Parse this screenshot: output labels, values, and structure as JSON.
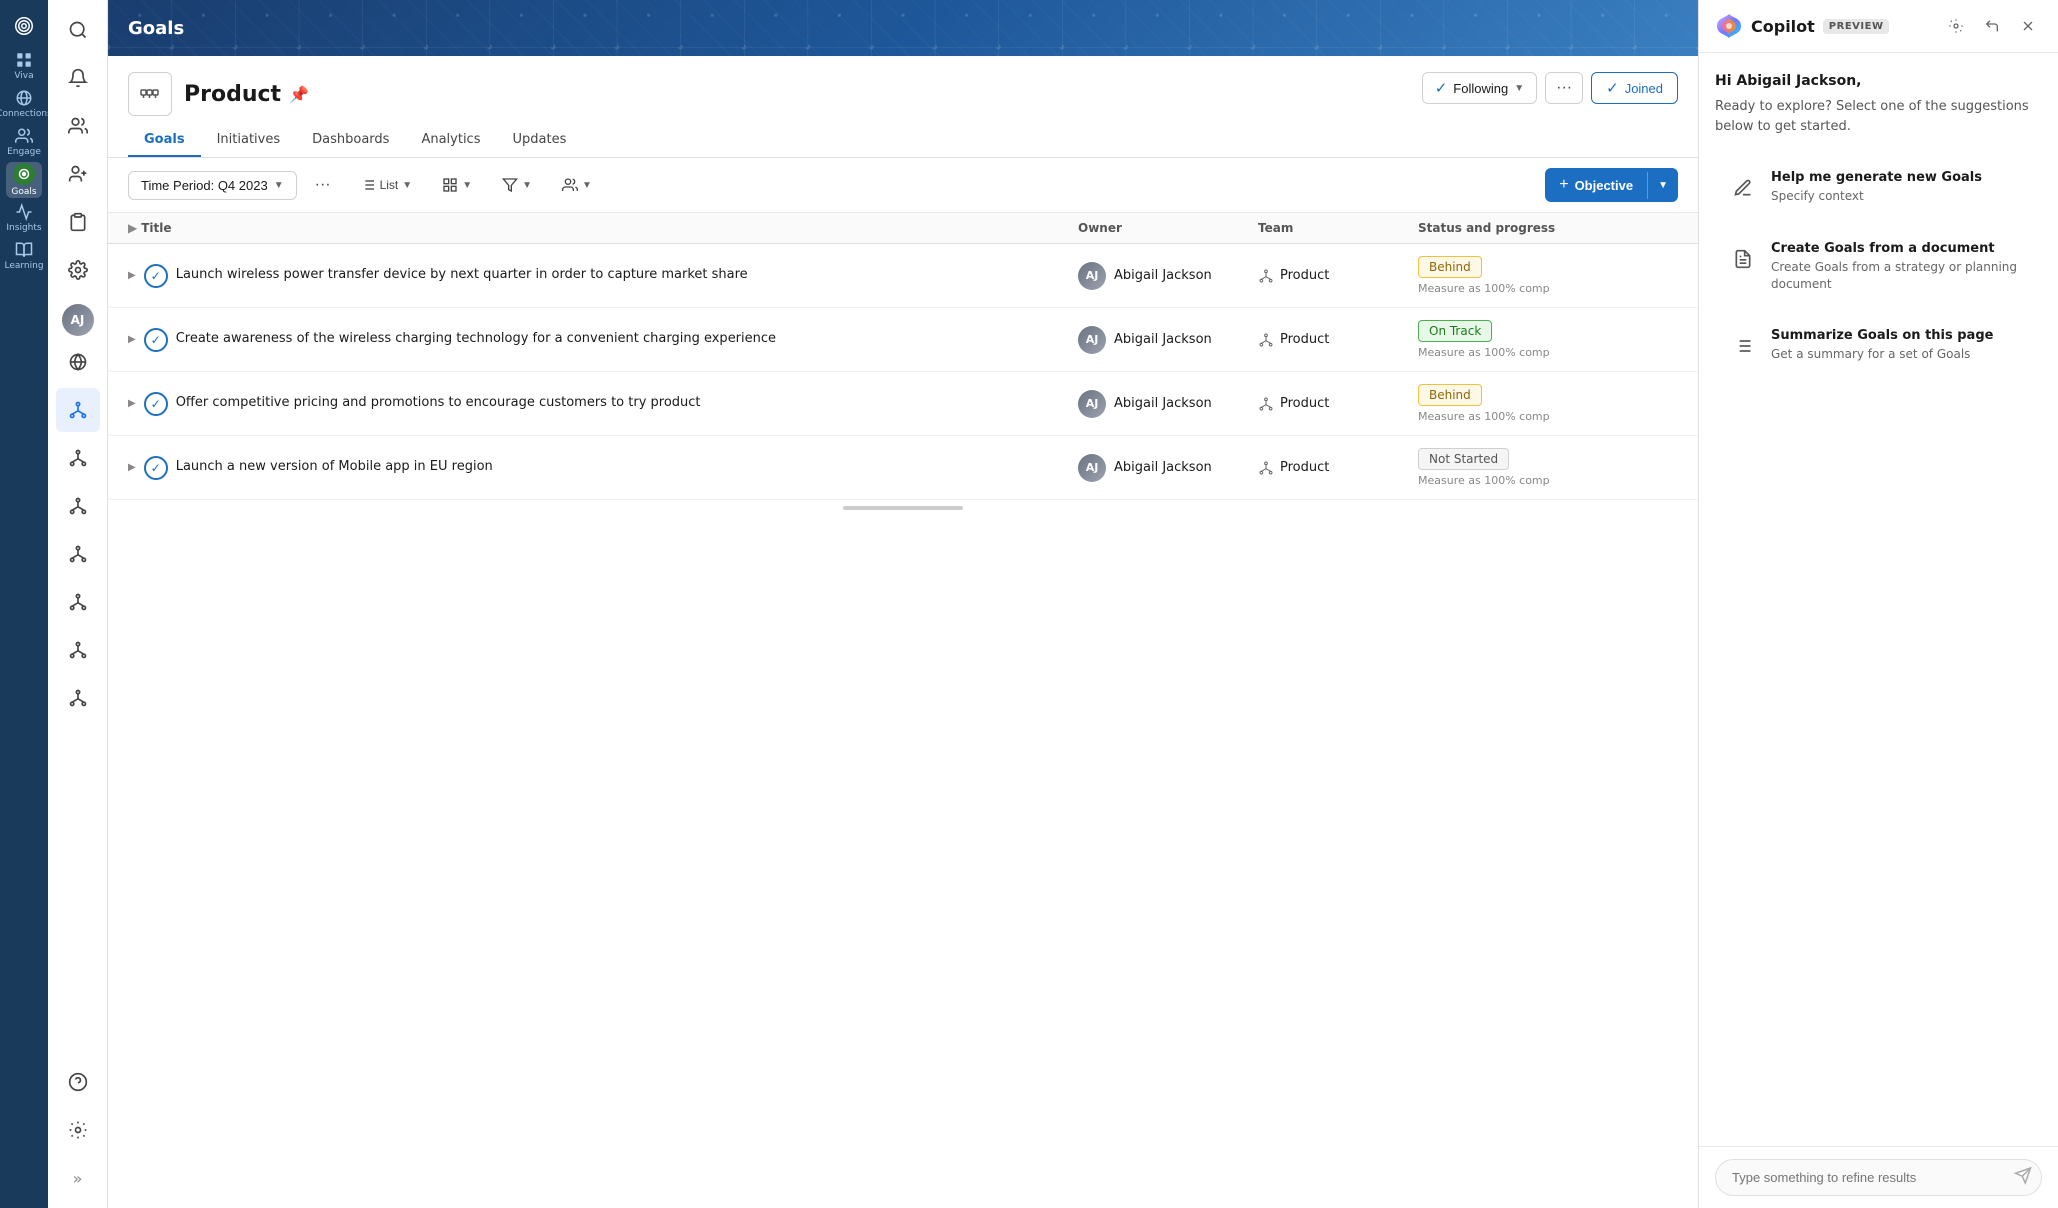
{
  "app": {
    "title": "Goals"
  },
  "farLeftNav": {
    "items": [
      {
        "id": "viva",
        "label": "Viva",
        "icon": "grid"
      },
      {
        "id": "connections",
        "label": "Connections",
        "icon": "globe"
      },
      {
        "id": "engage",
        "label": "Engage",
        "icon": "people"
      },
      {
        "id": "goals",
        "label": "Goals",
        "icon": "target",
        "active": true
      },
      {
        "id": "insights",
        "label": "Insights",
        "icon": "chart"
      },
      {
        "id": "learning",
        "label": "Learning",
        "icon": "book"
      }
    ]
  },
  "sidebar": {
    "items": [
      {
        "id": "search",
        "icon": "search"
      },
      {
        "id": "bell",
        "icon": "bell"
      },
      {
        "id": "people-group",
        "icon": "people-group"
      },
      {
        "id": "person-add",
        "icon": "person-add"
      },
      {
        "id": "clipboard",
        "icon": "clipboard"
      },
      {
        "id": "settings",
        "icon": "settings"
      },
      {
        "id": "avatar",
        "icon": "avatar"
      },
      {
        "id": "globe",
        "icon": "globe"
      },
      {
        "id": "hierarchy-active",
        "icon": "hierarchy",
        "active": true
      },
      {
        "id": "hierarchy1",
        "icon": "hierarchy"
      },
      {
        "id": "hierarchy2",
        "icon": "hierarchy"
      },
      {
        "id": "hierarchy3",
        "icon": "hierarchy"
      },
      {
        "id": "hierarchy4",
        "icon": "hierarchy"
      },
      {
        "id": "hierarchy5",
        "icon": "hierarchy"
      },
      {
        "id": "hierarchy6",
        "icon": "hierarchy"
      },
      {
        "id": "hierarchy7",
        "icon": "hierarchy"
      },
      {
        "id": "help",
        "icon": "help"
      },
      {
        "id": "settings2",
        "icon": "settings"
      }
    ]
  },
  "header": {
    "title": "Goals"
  },
  "page": {
    "title": "Product",
    "pinned": true,
    "tabs": [
      {
        "id": "goals",
        "label": "Goals",
        "active": true
      },
      {
        "id": "initiatives",
        "label": "Initiatives"
      },
      {
        "id": "dashboards",
        "label": "Dashboards"
      },
      {
        "id": "analytics",
        "label": "Analytics"
      },
      {
        "id": "updates",
        "label": "Updates"
      }
    ],
    "followingButton": "Following",
    "joinedButton": "Joined"
  },
  "toolbar": {
    "timePeriod": "Time Period: Q4 2023",
    "dotsLabel": "···",
    "objectiveButton": "Objective"
  },
  "table": {
    "columns": {
      "title": "Title",
      "owner": "Owner",
      "team": "Team",
      "status": "Status and progress"
    },
    "rows": [
      {
        "id": 1,
        "title": "Launch wireless power transfer device by next quarter in order to capture market share",
        "owner": "Abigail Jackson",
        "team": "Product",
        "status": "Behind",
        "statusType": "behind",
        "measure": "Measure as 100% comp"
      },
      {
        "id": 2,
        "title": "Create awareness of the wireless charging technology for a convenient charging experience",
        "owner": "Abigail Jackson",
        "team": "Product",
        "status": "On Track",
        "statusType": "on-track",
        "measure": "Measure as 100% comp"
      },
      {
        "id": 3,
        "title": "Offer competitive pricing and promotions to encourage customers to try product",
        "owner": "Abigail Jackson",
        "team": "Product",
        "status": "Behind",
        "statusType": "behind",
        "measure": "Measure as 100% comp"
      },
      {
        "id": 4,
        "title": "Launch a new version of Mobile app in EU region",
        "owner": "Abigail Jackson",
        "team": "Product",
        "status": "Not Started",
        "statusType": "not-started",
        "measure": "Measure as 100% comp"
      }
    ]
  },
  "copilot": {
    "title": "Copilot",
    "previewBadge": "PREVIEW",
    "greeting": "Hi Abigail Jackson,",
    "subtitle": "Ready to explore? Select one of the suggestions below to get started.",
    "suggestions": [
      {
        "id": "generate",
        "icon": "pencil",
        "title": "Help me generate new Goals",
        "description": "Specify context"
      },
      {
        "id": "from-doc",
        "icon": "document",
        "title": "Create Goals from a document",
        "description": "Create Goals from a strategy or planning document"
      },
      {
        "id": "summarize",
        "icon": "list",
        "title": "Summarize Goals on this page",
        "description": "Get a summary for a set of Goals"
      }
    ],
    "inputPlaceholder": "Type something to refine results"
  }
}
